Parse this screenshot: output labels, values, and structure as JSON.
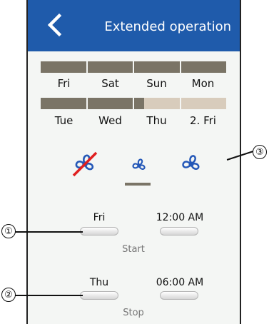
{
  "header": {
    "title": "Extended operation"
  },
  "week1": {
    "days": [
      "Fri",
      "Sat",
      "Sun",
      "Mon"
    ]
  },
  "week2": {
    "days": [
      "Tue",
      "Wed",
      "Thu",
      "2. Fri"
    ]
  },
  "start": {
    "day": "Fri",
    "time": "12:00 AM",
    "caption": "Start"
  },
  "stop": {
    "day": "Thu",
    "time": "06:00 AM",
    "caption": "Stop"
  },
  "callouts": {
    "one": "①",
    "two": "②",
    "three": "③"
  },
  "colors": {
    "header": "#1f5bab",
    "bar_dark": "#7a7466",
    "bar_light": "#d8ccbc",
    "fan_icon": "#2458b8",
    "strike": "#e02020"
  },
  "icons": [
    "back-chevron-icon",
    "fan-off-icon",
    "fan-low-icon",
    "fan-high-icon"
  ]
}
